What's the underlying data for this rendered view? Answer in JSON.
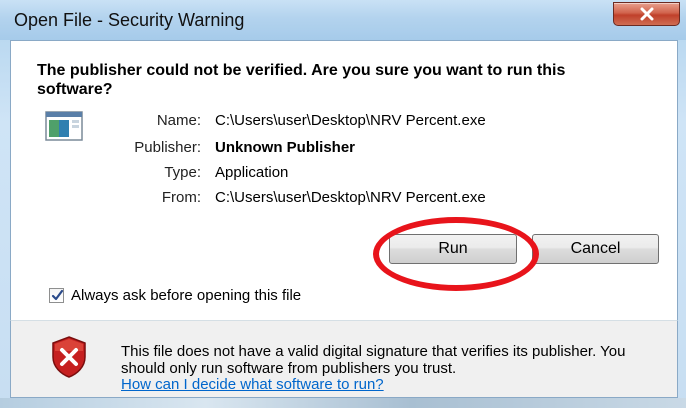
{
  "window": {
    "title": "Open File - Security Warning",
    "close_glyph": "X"
  },
  "headline": "The publisher could not be verified.  Are you sure you want to run this software?",
  "file_info": [
    {
      "label": "Name:",
      "value": "C:\\Users\\user\\Desktop\\NRV Percent.exe",
      "bold": false
    },
    {
      "label": "Publisher:",
      "value": "Unknown Publisher",
      "bold": true
    },
    {
      "label": "Type:",
      "value": "Application",
      "bold": false
    },
    {
      "label": "From:",
      "value": "C:\\Users\\user\\Desktop\\NRV Percent.exe",
      "bold": false
    }
  ],
  "buttons": {
    "run": "Run",
    "cancel": "Cancel"
  },
  "checkbox": {
    "label": "Always ask before opening this file",
    "checked": true
  },
  "footer": {
    "warning_text": "This file does not have a valid digital signature that verifies its publisher.  You should only run software from publishers you trust.",
    "help_link": "How can I decide what software to run?"
  },
  "icons": {
    "file": "application-file-icon",
    "shield": "red-x-shield-icon",
    "check": "checkmark-icon"
  },
  "colors": {
    "annotation_circle": "#e8141b",
    "link": "#0066cc",
    "close_button": "#c0402a"
  }
}
